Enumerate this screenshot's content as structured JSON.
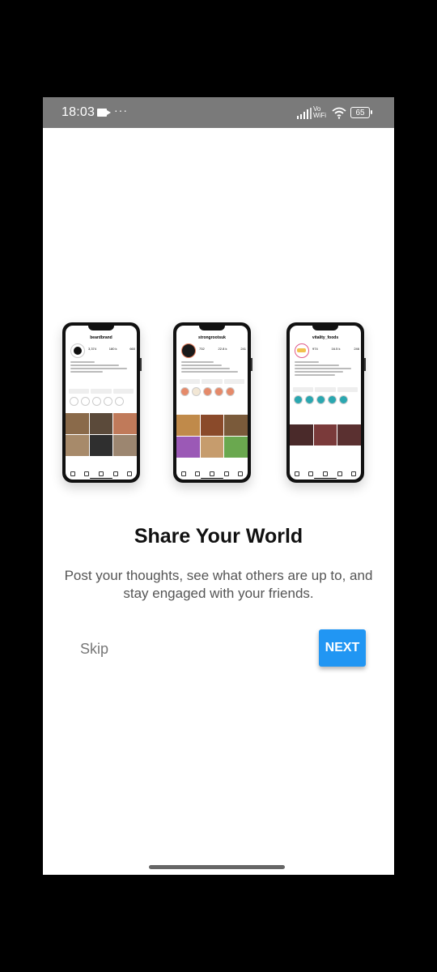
{
  "status_bar": {
    "time": "18:03",
    "more": "···",
    "network_label": "Vo\nWiFi",
    "battery": "65"
  },
  "phones": [
    {
      "profile_name": "beardbrand",
      "stats": [
        "3,374",
        "180 k",
        "660"
      ]
    },
    {
      "profile_name": "strongrootsuk",
      "stats": [
        "732",
        "22.8 k",
        "241"
      ]
    },
    {
      "profile_name": "vitality_foods",
      "stats": [
        "974",
        "16.5 k",
        "246"
      ]
    }
  ],
  "onboarding": {
    "title": "Share Your World",
    "description": "Post your thoughts, see what others are up to, and stay engaged with your friends.",
    "skip_label": "Skip",
    "next_label": "NEXT"
  },
  "colors": {
    "accent": "#2196f3",
    "status_bar": "#7a7a7a"
  }
}
